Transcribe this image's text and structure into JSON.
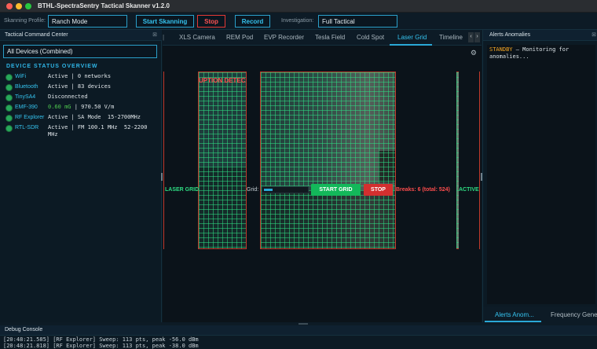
{
  "window": {
    "title": "BTHL-SpectraSentry Tactical Skanner v1.2.0"
  },
  "toolbar": {
    "profile_label": "Skanning Profile:",
    "profile_value": "Ranch Mode",
    "start_label": "Start Skanning",
    "stop_label": "Stop",
    "record_label": "Record",
    "investigation_label": "Investigation:",
    "investigation_value": "Full Tactical"
  },
  "left_panel": {
    "title": "Tactical Command Center",
    "device_selector": "All Devices (Combined)",
    "section_title": "DEVICE STATUS OVERVIEW",
    "devices": [
      {
        "name": "WiFi",
        "status": "Active | 0 networks"
      },
      {
        "name": "Bluetooth",
        "status": "Active | 83 devices"
      },
      {
        "name": "TinySA4",
        "status": "Disconnected"
      },
      {
        "name": "EMF-390",
        "status_highlight": "0.60 mG",
        "status": "| 970.50 V/m"
      },
      {
        "name": "RF Explorer",
        "status": "Active | SA Mode  15-2700MHz"
      },
      {
        "name": "RTL-SDR",
        "status": "Active | FM 100.1 MHz  52-2200\nMHz"
      }
    ]
  },
  "tabs": {
    "arrow_left": "‹",
    "arrow_right": "›",
    "items": [
      "XLS Camera",
      "REM Pod",
      "EVP Recorder",
      "Tesla Field",
      "Cold Spot",
      "Laser Grid",
      "Timeline"
    ],
    "active": "Laser Grid"
  },
  "laser_grid": {
    "interruption_text": "UPTION DETEC",
    "left_label": "LASER GRID",
    "right_label": "ACTIVE",
    "grid_label": "Grid:",
    "grid_progress": 0.2,
    "start_label": "START GRID",
    "stop_label": "STOP",
    "breaks_text": "Breaks: 6 (total: 524)"
  },
  "right_panel": {
    "title": "Alerts  Anomalies",
    "standby": "STANDBY",
    "message": " – Monitoring for\nanomalies...",
    "tabs": [
      "Alerts  Anom...",
      "Frequency Gener..."
    ]
  },
  "debug": {
    "title": "Debug Console",
    "lines": [
      "[20:48:21.585] [RF Explorer] Sweep: 113 pts, peak -56.0 dBm",
      "[20:48:21.818] [RF Explorer] Sweep: 113 pts, peak -38.0 dBm"
    ]
  },
  "colors": {
    "accent": "#2fb6e8",
    "danger": "#e53935",
    "success": "#13b85a",
    "laser": "#2edc82"
  },
  "icons": {
    "settings": "gear-icon",
    "close": "close-icon"
  }
}
